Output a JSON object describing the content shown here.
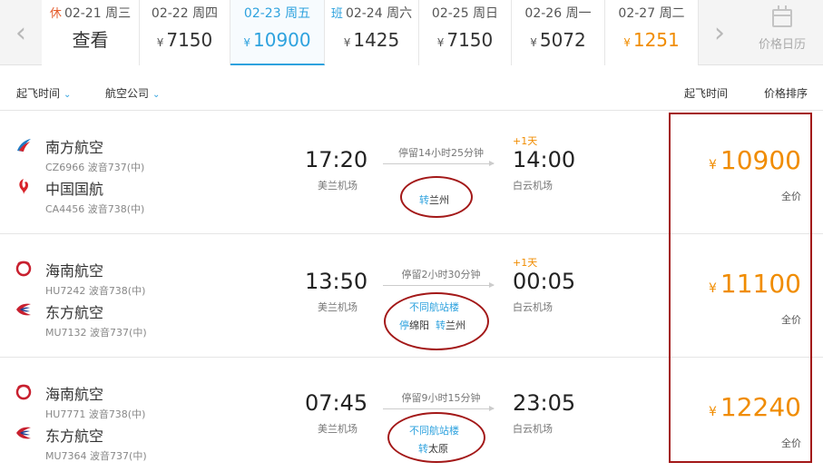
{
  "dates": [
    {
      "tag": "休",
      "date": "02-21",
      "weekday": "周三",
      "price": "",
      "label": "查看"
    },
    {
      "tag": "",
      "date": "02-22",
      "weekday": "周四",
      "price": "7150"
    },
    {
      "tag": "",
      "date": "02-23",
      "weekday": "周五",
      "price": "10900"
    },
    {
      "tag": "班",
      "date": "02-24",
      "weekday": "周六",
      "price": "1425"
    },
    {
      "tag": "",
      "date": "02-25",
      "weekday": "周日",
      "price": "7150"
    },
    {
      "tag": "",
      "date": "02-26",
      "weekday": "周一",
      "price": "5072"
    },
    {
      "tag": "",
      "date": "02-27",
      "weekday": "周二",
      "price": "1251"
    }
  ],
  "currency": "¥",
  "selected_date_index": 2,
  "lowest_price_index": 6,
  "calendar_label": "价格日历",
  "sort_bar": {
    "departure_time_filter": "起飞时间",
    "airline_filter": "航空公司",
    "sort_by_departure": "起飞时间",
    "sort_by_price": "价格排序"
  },
  "flights": [
    {
      "leg1": {
        "airline": "南方航空",
        "info": "CZ6966 波音737(中)",
        "logo": "china-southern-logo"
      },
      "leg2": {
        "airline": "中国国航",
        "info": "CA4456 波音738(中)",
        "logo": "air-china-logo"
      },
      "dep_time": "17:20",
      "dep_airport": "美兰机场",
      "stopover": "停留14小时25分钟",
      "terminal_note": "",
      "stop_city_prefix": "",
      "stop_city": "",
      "transfer_prefix": "转",
      "transfer_city": "兰州",
      "plus_day": "+1天",
      "arr_time": "14:00",
      "arr_airport": "白云机场",
      "price": "10900",
      "fare_type": "全价"
    },
    {
      "leg1": {
        "airline": "海南航空",
        "info": "HU7242 波音738(中)",
        "logo": "hainan-airlines-logo"
      },
      "leg2": {
        "airline": "东方航空",
        "info": "MU7132 波音737(中)",
        "logo": "china-eastern-logo"
      },
      "dep_time": "13:50",
      "dep_airport": "美兰机场",
      "stopover": "停留2小时30分钟",
      "terminal_note": "不同航站楼",
      "stop_city_prefix": "停",
      "stop_city": "绵阳",
      "transfer_prefix": "转",
      "transfer_city": "兰州",
      "plus_day": "+1天",
      "arr_time": "00:05",
      "arr_airport": "白云机场",
      "price": "11100",
      "fare_type": "全价"
    },
    {
      "leg1": {
        "airline": "海南航空",
        "info": "HU7771 波音738(中)",
        "logo": "hainan-airlines-logo"
      },
      "leg2": {
        "airline": "东方航空",
        "info": "MU7364 波音737(中)",
        "logo": "china-eastern-logo"
      },
      "dep_time": "07:45",
      "dep_airport": "美兰机场",
      "stopover": "停留9小时15分钟",
      "terminal_note": "不同航站楼",
      "stop_city_prefix": "",
      "stop_city": "",
      "transfer_prefix": "转",
      "transfer_city": "太原",
      "plus_day": "",
      "arr_time": "23:05",
      "arr_airport": "白云机场",
      "price": "12240",
      "fare_type": "全价"
    }
  ],
  "colors": {
    "accent": "#2ea2de",
    "price": "#f08c00",
    "annotation": "#a31818",
    "rest_tag": "#e45c2c"
  }
}
